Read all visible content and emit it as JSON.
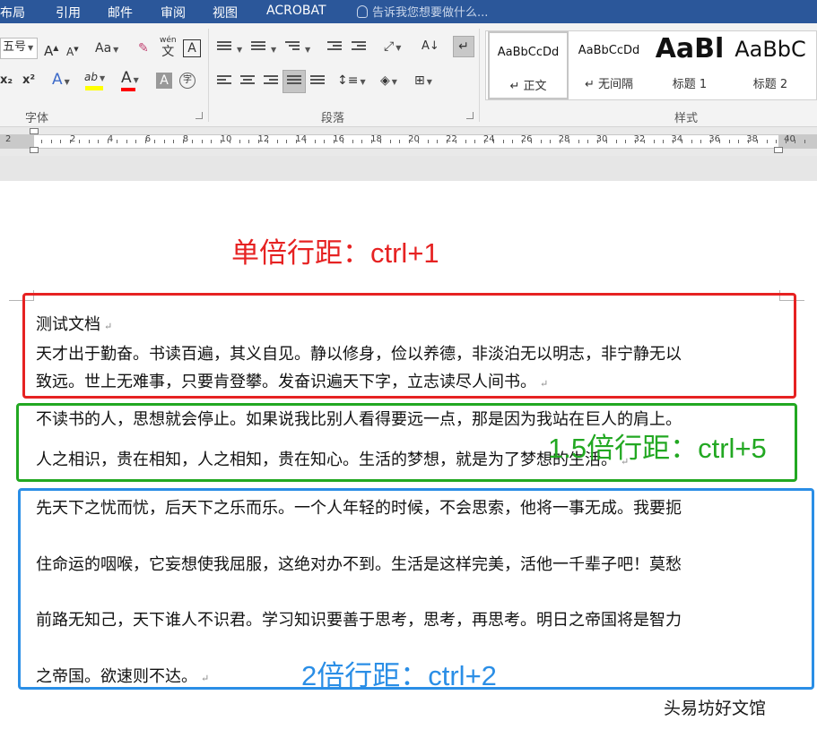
{
  "menu": {
    "tabs": [
      "布局",
      "引用",
      "邮件",
      "审阅",
      "视图",
      "ACROBAT"
    ],
    "tell_me": "告诉我您想要做什么..."
  },
  "ribbon": {
    "font_size_value": "五号",
    "grow_font": "A",
    "shrink_font": "A",
    "change_case": "Aa",
    "phonetic_top": "wén",
    "phonetic_bottom": "文",
    "char_border": "A",
    "subscript": "x₂",
    "superscript": "x²",
    "text_effects": "A",
    "highlight": "ab",
    "font_color": "A",
    "char_shading": "A",
    "enclose_char": "字",
    "sort": "A↓",
    "font_group_label": "字体",
    "paragraph_group_label": "段落",
    "styles_group_label": "样式",
    "styles": [
      {
        "preview": "AaBbCcDd",
        "name": "正文"
      },
      {
        "preview": "AaBbCcDd",
        "name": "无间隔"
      },
      {
        "preview": "AaBl",
        "name": "标题 1"
      },
      {
        "preview": "AaBbC",
        "name": "标题 2"
      }
    ],
    "highlight_color": "#ffff00",
    "font_color_bar": "#ff0000"
  },
  "ruler": {
    "numbers": [
      "2",
      "2",
      "4",
      "6",
      "8",
      "10",
      "12",
      "14",
      "16",
      "18",
      "20",
      "22",
      "24",
      "26",
      "28",
      "30",
      "32",
      "34",
      "36",
      "38",
      "40"
    ]
  },
  "document": {
    "title_line": "测试文档",
    "single_lines": [
      "天才出于勤奋。书读百遍，其义自见。静以修身，俭以养德，非淡泊无以明志，非宁静无以",
      "致远。世上无难事，只要肯登攀。发奋识遍天下字，立志读尽人间书。"
    ],
    "one_half_lines": [
      "不读书的人，思想就会停止。如果说我比别人看得要远一点，那是因为我站在巨人的肩上。",
      "人之相识，贵在相知，人之相知，贵在知心。生活的梦想，就是为了梦想的生活。"
    ],
    "double_lines": [
      "先天下之忧而忧，后天下之乐而乐。一个人年轻的时候，不会思索，他将一事无成。我要扼",
      "住命运的咽喉，它妄想使我屈服，这绝对办不到。生活是这样完美，活他一千辈子吧！莫愁",
      "前路无知己，天下谁人不识君。学习知识要善于思考，思考，再思考。明日之帝国将是智力",
      "之帝国。欲速则不达。"
    ],
    "paragraph_mark": "↵"
  },
  "annotations": {
    "single": "单倍行距：ctrl+1",
    "one_half": "1.5倍行距：ctrl+5",
    "double": "2倍行距：ctrl+2",
    "color_single": "#e62222",
    "color_one_half": "#22a822",
    "color_double": "#2a8ee6"
  },
  "watermark": "头易坊好文馆"
}
